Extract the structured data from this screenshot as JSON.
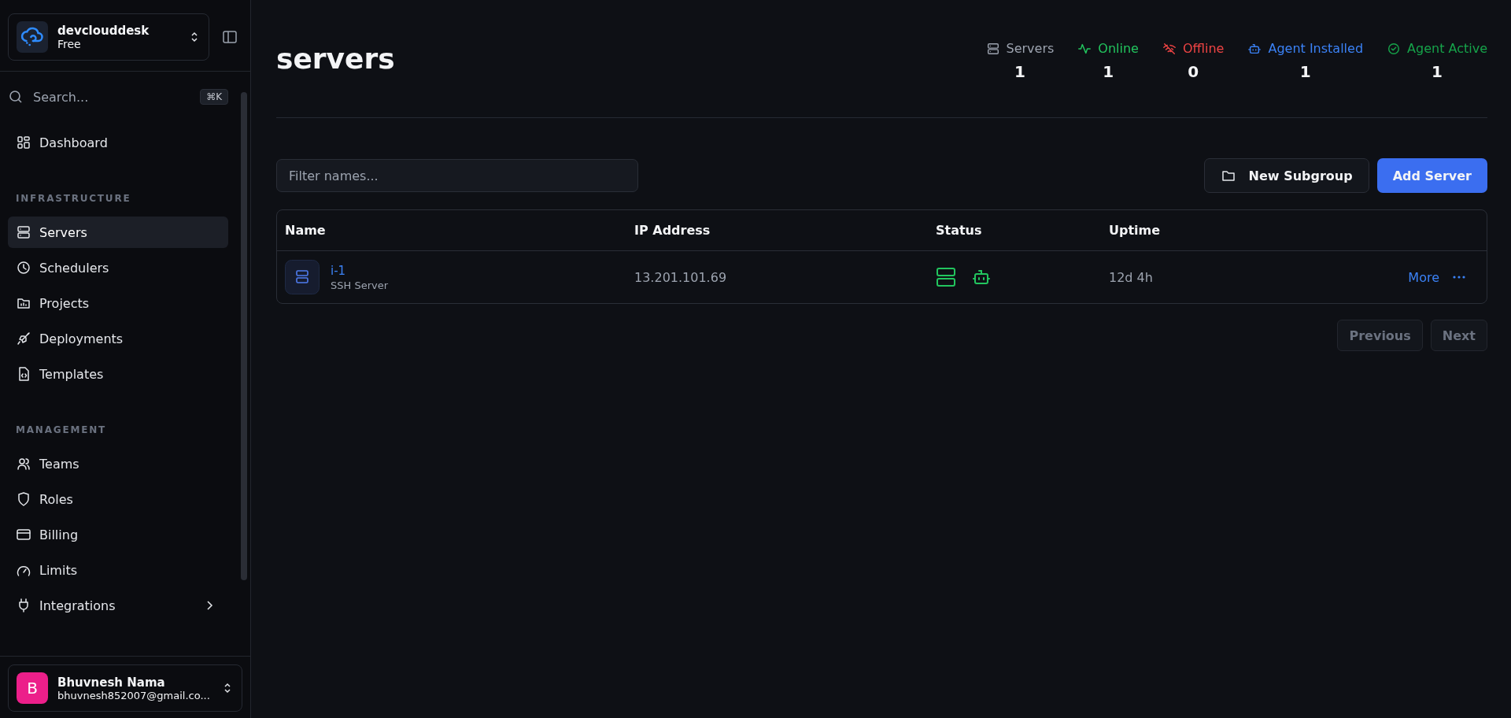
{
  "workspace": {
    "name": "devclouddesk",
    "plan": "Free"
  },
  "search": {
    "placeholder": "Search...",
    "shortcut": "⌘K"
  },
  "sidebar": {
    "sections": [
      {
        "items": [
          {
            "label": "Dashboard",
            "selected": false,
            "has_submenu": false
          }
        ]
      },
      {
        "heading": "INFRASTRUCTURE",
        "items": [
          {
            "label": "Servers",
            "selected": true,
            "has_submenu": false
          },
          {
            "label": "Schedulers",
            "selected": false,
            "has_submenu": false
          },
          {
            "label": "Projects",
            "selected": false,
            "has_submenu": false
          },
          {
            "label": "Deployments",
            "selected": false,
            "has_submenu": false
          },
          {
            "label": "Templates",
            "selected": false,
            "has_submenu": false
          }
        ]
      },
      {
        "heading": "MANAGEMENT",
        "items": [
          {
            "label": "Teams",
            "selected": false,
            "has_submenu": false
          },
          {
            "label": "Roles",
            "selected": false,
            "has_submenu": false
          },
          {
            "label": "Billing",
            "selected": false,
            "has_submenu": false
          },
          {
            "label": "Limits",
            "selected": false,
            "has_submenu": false
          },
          {
            "label": "Integrations",
            "selected": false,
            "has_submenu": true
          }
        ]
      }
    ]
  },
  "user": {
    "initial": "B",
    "name": "Bhuvnesh Nama",
    "email": "bhuvnesh852007@gmail.co..."
  },
  "page": {
    "title": "servers"
  },
  "stats": [
    {
      "kind": "servers",
      "label": "Servers",
      "value": "1",
      "color": "#9ca3af"
    },
    {
      "kind": "online",
      "label": "Online",
      "value": "1",
      "color": "#22c55e"
    },
    {
      "kind": "offline",
      "label": "Offline",
      "value": "0",
      "color": "#ef4444"
    },
    {
      "kind": "agent_installed",
      "label": "Agent Installed",
      "value": "1",
      "color": "#3b82f6"
    },
    {
      "kind": "agent_active",
      "label": "Agent Active",
      "value": "1",
      "color": "#16a34a"
    }
  ],
  "filter": {
    "placeholder": "Filter names..."
  },
  "actions": {
    "new_subgroup": "New Subgroup",
    "add_server": "Add Server"
  },
  "table": {
    "columns": [
      "Name",
      "IP Address",
      "Status",
      "Uptime"
    ],
    "rows": [
      {
        "name": "i-1",
        "type": "SSH Server",
        "ip": "13.201.101.69",
        "online": true,
        "agent_installed": true,
        "uptime": "12d 4h",
        "more": "More"
      }
    ]
  },
  "pagination": {
    "previous": {
      "label": "Previous",
      "disabled": true
    },
    "next": {
      "label": "Next",
      "disabled": true
    }
  }
}
